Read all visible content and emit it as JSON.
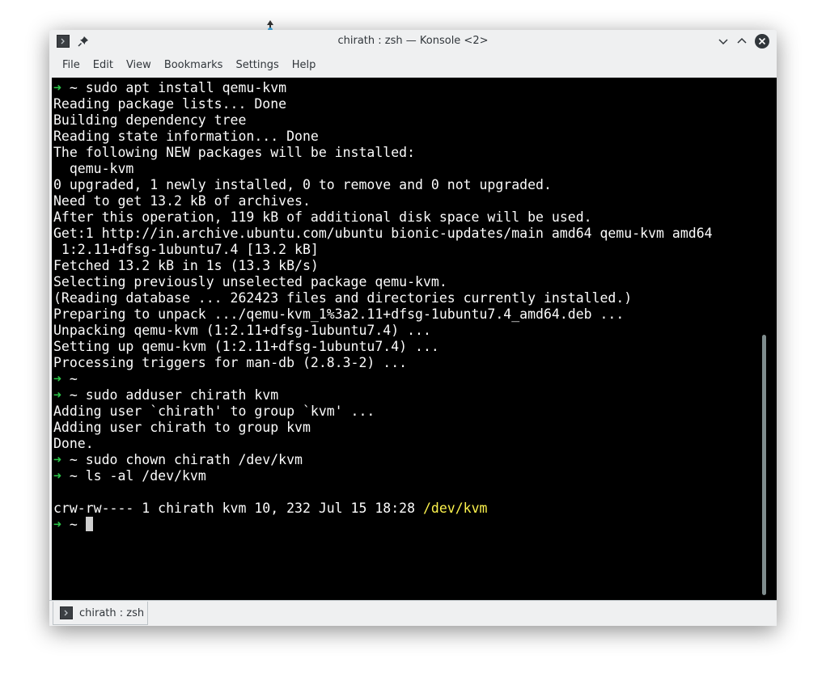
{
  "window": {
    "title": "chirath : zsh — Konsole <2>"
  },
  "menu": [
    "File",
    "Edit",
    "View",
    "Bookmarks",
    "Settings",
    "Help"
  ],
  "terminal": {
    "lines": [
      {
        "prompt": true,
        "text": " ~ sudo apt install qemu-kvm"
      },
      {
        "text": "Reading package lists... Done"
      },
      {
        "text": "Building dependency tree"
      },
      {
        "text": "Reading state information... Done"
      },
      {
        "text": "The following NEW packages will be installed:"
      },
      {
        "text": "  qemu-kvm"
      },
      {
        "text": "0 upgraded, 1 newly installed, 0 to remove and 0 not upgraded."
      },
      {
        "text": "Need to get 13.2 kB of archives."
      },
      {
        "text": "After this operation, 119 kB of additional disk space will be used."
      },
      {
        "text": "Get:1 http://in.archive.ubuntu.com/ubuntu bionic-updates/main amd64 qemu-kvm amd64"
      },
      {
        "text": " 1:2.11+dfsg-1ubuntu7.4 [13.2 kB]"
      },
      {
        "text": "Fetched 13.2 kB in 1s (13.3 kB/s)"
      },
      {
        "text": "Selecting previously unselected package qemu-kvm."
      },
      {
        "text": "(Reading database ... 262423 files and directories currently installed.)"
      },
      {
        "text": "Preparing to unpack .../qemu-kvm_1%3a2.11+dfsg-1ubuntu7.4_amd64.deb ..."
      },
      {
        "text": "Unpacking qemu-kvm (1:2.11+dfsg-1ubuntu7.4) ..."
      },
      {
        "text": "Setting up qemu-kvm (1:2.11+dfsg-1ubuntu7.4) ..."
      },
      {
        "text": "Processing triggers for man-db (2.8.3-2) ..."
      },
      {
        "prompt": true,
        "text": " ~"
      },
      {
        "prompt": true,
        "text": " ~ sudo adduser chirath kvm"
      },
      {
        "text": "Adding user `chirath' to group `kvm' ..."
      },
      {
        "text": "Adding user chirath to group kvm"
      },
      {
        "text": "Done."
      },
      {
        "prompt": true,
        "text": " ~ sudo chown chirath /dev/kvm"
      },
      {
        "prompt": true,
        "text": " ~ ls -al /dev/kvm"
      },
      {
        "text": ""
      },
      {
        "text": "crw-rw---- 1 chirath kvm 10, 232 Jul 15 18:28 ",
        "highlight": "/dev/kvm"
      },
      {
        "prompt": true,
        "text": " ~ ",
        "cursor": true
      }
    ],
    "prompt_arrow": "➜",
    "colors": {
      "background": "#000000",
      "foreground": "#fcfcfc",
      "prompt_arrow": "#2cc84a",
      "highlight": "#fdf34d"
    }
  },
  "tabs": [
    {
      "label": "chirath : zsh"
    }
  ]
}
